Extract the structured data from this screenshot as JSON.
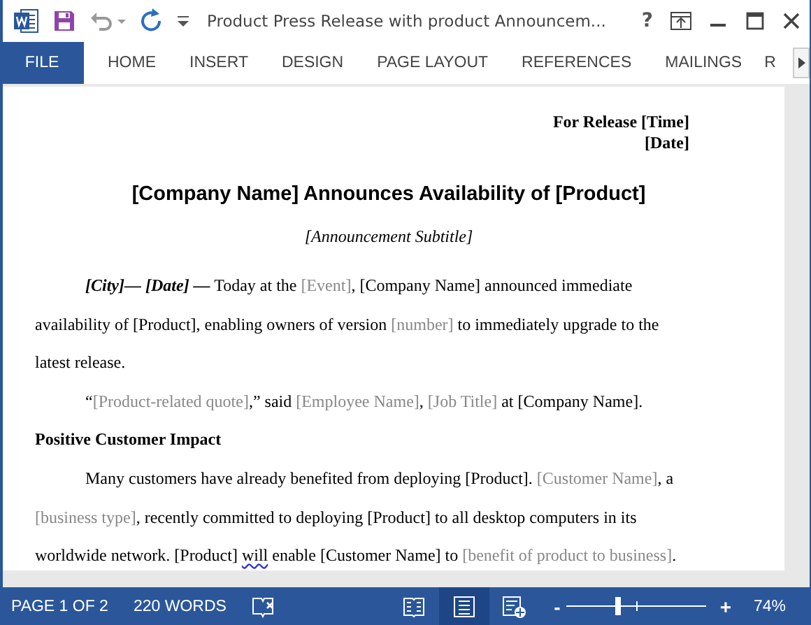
{
  "window": {
    "title": "Product Press Release with product Announcem...",
    "help": "?"
  },
  "tabs": [
    {
      "label": "FILE",
      "selected": true
    },
    {
      "label": "HOME",
      "selected": false
    },
    {
      "label": "INSERT",
      "selected": false
    },
    {
      "label": "DESIGN",
      "selected": false
    },
    {
      "label": "PAGE LAYOUT",
      "selected": false
    },
    {
      "label": "REFERENCES",
      "selected": false
    },
    {
      "label": "MAILINGS",
      "selected": false
    },
    {
      "label": "R",
      "selected": false
    }
  ],
  "document": {
    "release": [
      "For Release [Time]",
      "[Date]"
    ],
    "heading": "[Company Name] Announces Availability of [Product]",
    "subtitle": "[Announcement Subtitle]",
    "blocks": [
      {
        "kind": "paragraph",
        "runs": [
          {
            "kind": "lead",
            "text": "[City]— [Date] —"
          },
          {
            "kind": "plain",
            "text": " Today at the "
          },
          {
            "kind": "placeholder",
            "text": "[Event]"
          },
          {
            "kind": "plain",
            "text": ", [Company Name] announced immediate availability of [Product], enabling owners of version "
          },
          {
            "kind": "placeholder",
            "text": "[number]"
          },
          {
            "kind": "plain",
            "text": " to immediately upgrade to the latest release."
          }
        ]
      },
      {
        "kind": "paragraph",
        "runs": [
          {
            "kind": "plain",
            "text": "“"
          },
          {
            "kind": "placeholder",
            "text": "[Product-related quote]"
          },
          {
            "kind": "plain",
            "text": ",” said "
          },
          {
            "kind": "placeholder",
            "text": "[Employee Name]"
          },
          {
            "kind": "plain",
            "text": ", "
          },
          {
            "kind": "placeholder",
            "text": "[Job Title]"
          },
          {
            "kind": "plain",
            "text": " at [Company Name]."
          }
        ]
      },
      {
        "kind": "heading",
        "text": "Positive Customer Impact"
      },
      {
        "kind": "paragraph",
        "runs": [
          {
            "kind": "plain",
            "text": "Many customers have already benefited from deploying [Product]. "
          },
          {
            "kind": "placeholder",
            "text": "[Customer Name]"
          },
          {
            "kind": "plain",
            "text": ", a "
          },
          {
            "kind": "placeholder",
            "text": "[business type]"
          },
          {
            "kind": "plain",
            "text": ", recently committed to deploying [Product] to all desktop computers in its worldwide network. [Product] "
          },
          {
            "kind": "flagged",
            "text": "will"
          },
          {
            "kind": "plain",
            "text": " enable [Customer Name] to "
          },
          {
            "kind": "placeholder",
            "text": "[benefit of product to business]"
          },
          {
            "kind": "plain",
            "text": "."
          }
        ]
      }
    ]
  },
  "status_bar": {
    "page": "PAGE 1 OF 2",
    "words": "220 WORDS",
    "views": [
      {
        "selected": false
      },
      {
        "selected": true
      },
      {
        "selected": false
      }
    ],
    "zoom": {
      "minus": "-",
      "plus": "+",
      "level": 0.37,
      "reading": "74%"
    }
  }
}
